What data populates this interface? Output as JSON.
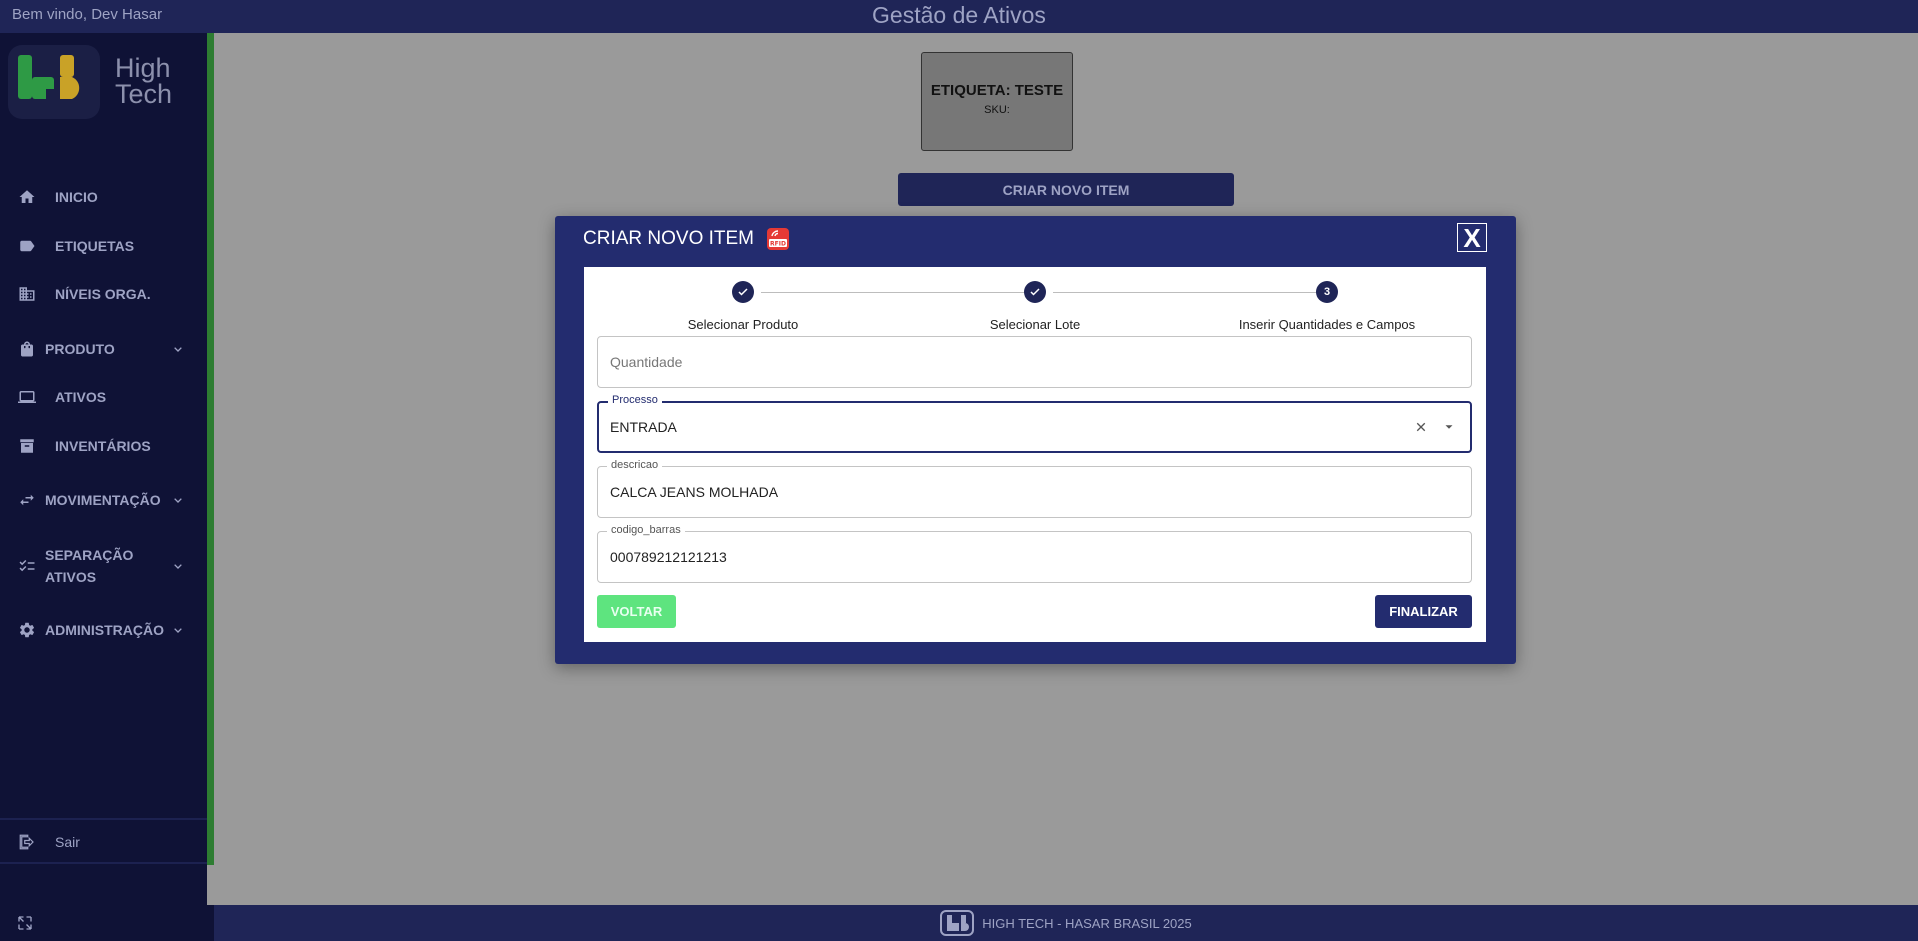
{
  "header": {
    "welcome": "Bem vindo, Dev Hasar",
    "title": "Gestão de Ativos"
  },
  "logo": {
    "line1": "High",
    "line2": "Tech"
  },
  "sidebar": {
    "items": [
      {
        "label": "INICIO",
        "icon": "home-icon"
      },
      {
        "label": "ETIQUETAS",
        "icon": "tag-icon"
      },
      {
        "label": "NÍVEIS ORGA.",
        "icon": "building-icon"
      },
      {
        "label": "PRODUTO",
        "icon": "bag-icon",
        "expandable": true
      },
      {
        "label": "ATIVOS",
        "icon": "laptop-icon"
      },
      {
        "label": "INVENTÁRIOS",
        "icon": "archive-icon"
      },
      {
        "label": "MOVIMENTAÇÃO",
        "icon": "swap-icon",
        "expandable": true
      },
      {
        "label_line1": "SEPARAÇÃO",
        "label_line2": "ATIVOS",
        "icon": "checklist-icon",
        "expandable": true
      },
      {
        "label": "ADMINISTRAÇÃO",
        "icon": "gear-icon",
        "expandable": true
      }
    ],
    "logout": "Sair"
  },
  "tag_preview": {
    "title": "ETIQUETA: TESTE",
    "sku": "SKU:"
  },
  "create_button": "CRIAR NOVO ITEM",
  "modal": {
    "title": "CRIAR NOVO ITEM",
    "close": "X",
    "steps": [
      {
        "label": "Selecionar Produto",
        "state": "done"
      },
      {
        "label": "Selecionar Lote",
        "state": "done"
      },
      {
        "label": "Inserir Quantidades e Campos",
        "state": "active",
        "number": "3"
      }
    ],
    "fields": {
      "quantidade": {
        "placeholder": "Quantidade",
        "value": ""
      },
      "processo": {
        "label": "Processo",
        "value": "ENTRADA"
      },
      "descricao": {
        "label": "descricao",
        "value": "CALCA JEANS MOLHADA"
      },
      "codigo_barras": {
        "label": "codigo_barras",
        "value": "000789212121213"
      }
    },
    "back": "VOLTAR",
    "finish": "FINALIZAR"
  },
  "footer": {
    "text": "HIGH TECH - HASAR BRASIL 2025"
  },
  "colors": {
    "navy": "#1f2557",
    "modal": "#232c6f",
    "sidebar": "#0f1236",
    "accent_green": "#2e7d32",
    "back_green": "#5ee47f",
    "logo_green": "#2e9a45",
    "logo_yellow": "#c9a227"
  }
}
